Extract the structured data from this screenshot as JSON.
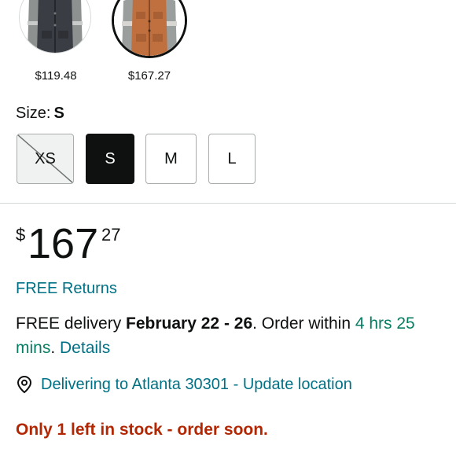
{
  "swatches": [
    {
      "price": "$119.48",
      "color_name": "charcoal",
      "selected": false
    },
    {
      "price": "$167.27",
      "color_name": "brown",
      "selected": true
    }
  ],
  "size": {
    "label": "Size:",
    "selected": "S",
    "options": [
      {
        "label": "XS",
        "available": false
      },
      {
        "label": "S",
        "available": true,
        "selected": true
      },
      {
        "label": "M",
        "available": true
      },
      {
        "label": "L",
        "available": true
      }
    ]
  },
  "price": {
    "symbol": "$",
    "whole": "167",
    "fraction": "27"
  },
  "returns": {
    "label": "FREE Returns"
  },
  "delivery": {
    "prefix": "FREE delivery ",
    "dates": "February 22 - 26",
    "order_within": ". Order within ",
    "countdown": "4 hrs 25 mins",
    "period": ". ",
    "details_link": "Details"
  },
  "location": {
    "icon": "location-pin-icon",
    "text": "Delivering to Atlanta 30301 - Update location"
  },
  "stock": {
    "text": "Only 1 left in stock - order soon."
  },
  "colors": {
    "link": "#007185",
    "green": "#067d62",
    "stock_red": "#b12704",
    "text": "#0f1111",
    "selected_bg": "#0f1111"
  }
}
